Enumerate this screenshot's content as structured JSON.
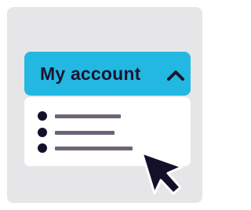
{
  "account_menu": {
    "label": "My account",
    "chevron_icon": "chevron-up-icon",
    "accent_color": "#22b8e2",
    "items": [
      {
        "icon": "bullet-icon"
      },
      {
        "icon": "bullet-icon"
      },
      {
        "icon": "bullet-icon"
      }
    ]
  },
  "cursor": {
    "icon": "mouse-pointer-icon"
  }
}
